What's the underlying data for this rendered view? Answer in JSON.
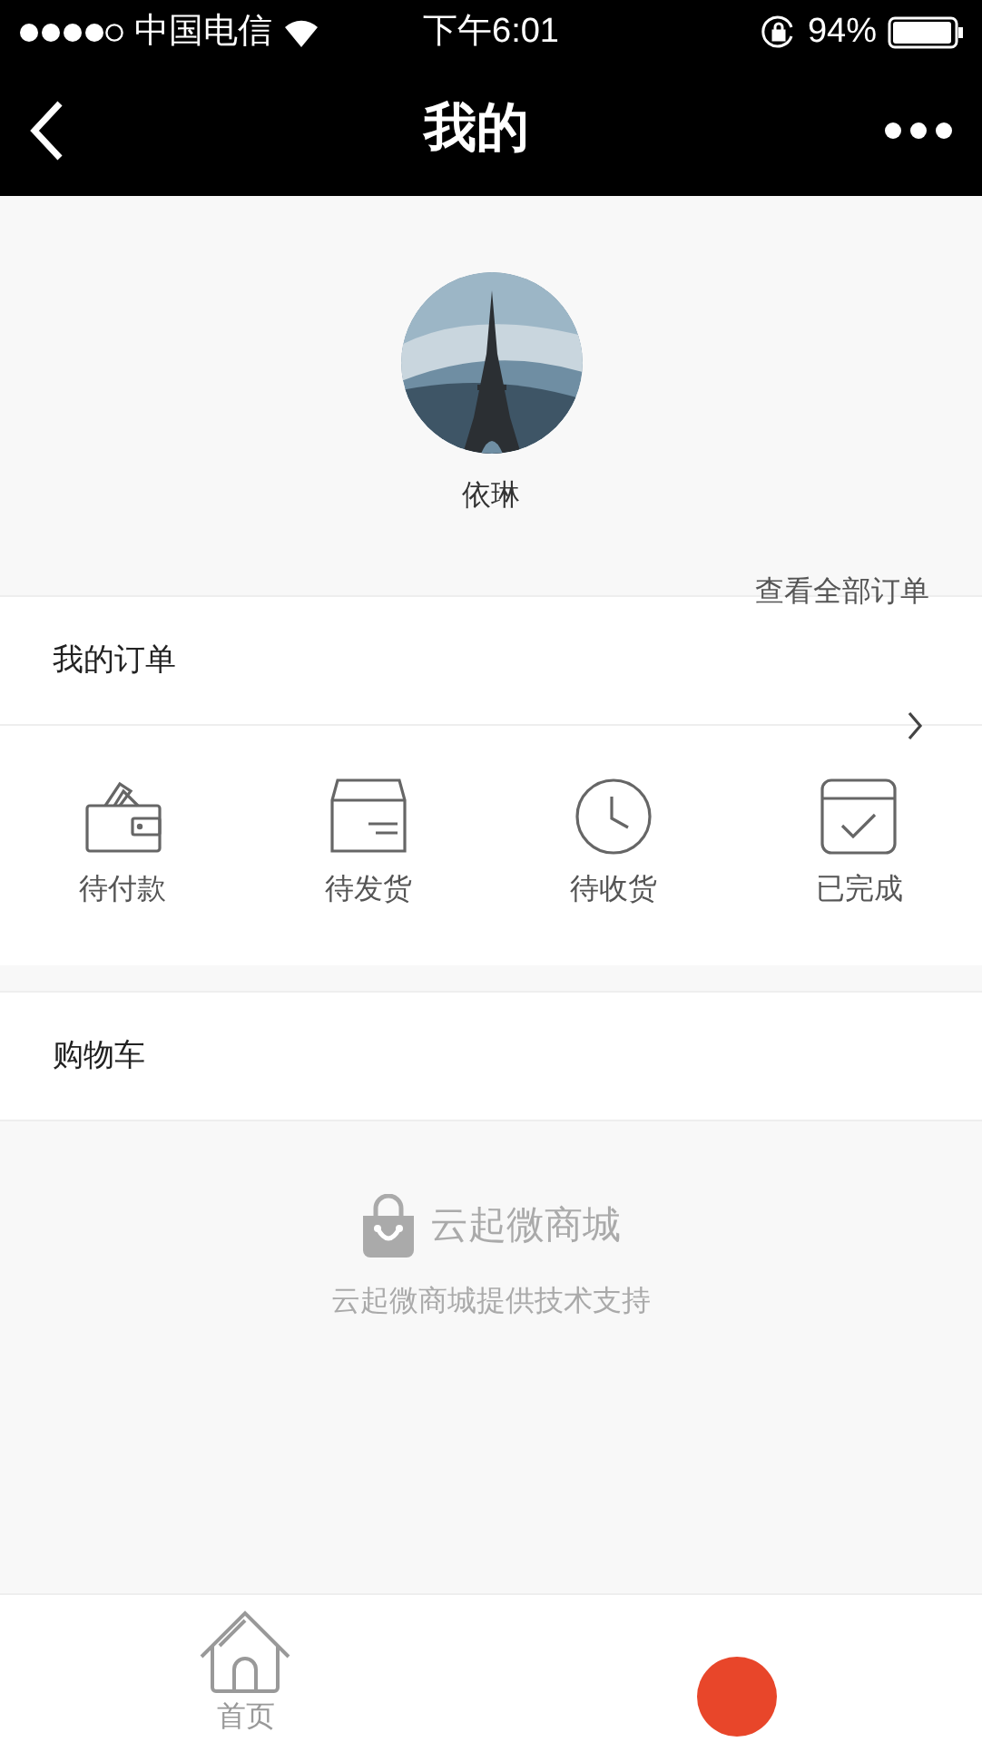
{
  "status_bar": {
    "carrier": "中国电信",
    "time": "下午6:01",
    "battery": "94%"
  },
  "nav_bar": {
    "title": "我的"
  },
  "profile": {
    "name": "依琳",
    "view_all_orders": "查看全部订单"
  },
  "orders": {
    "title": "我的订单",
    "statuses": [
      {
        "kind": "wallet",
        "label": "待付款"
      },
      {
        "kind": "box",
        "label": "待发货"
      },
      {
        "kind": "clock",
        "label": "待收货"
      },
      {
        "kind": "done",
        "label": "已完成"
      }
    ]
  },
  "cart": {
    "title": "购物车"
  },
  "footer": {
    "brand": "云起微商城",
    "support": "云起微商城提供技术支持"
  },
  "tab_bar": [
    {
      "kind": "home",
      "label": "首页",
      "selected": false
    },
    {
      "kind": "me",
      "selected": true
    }
  ]
}
